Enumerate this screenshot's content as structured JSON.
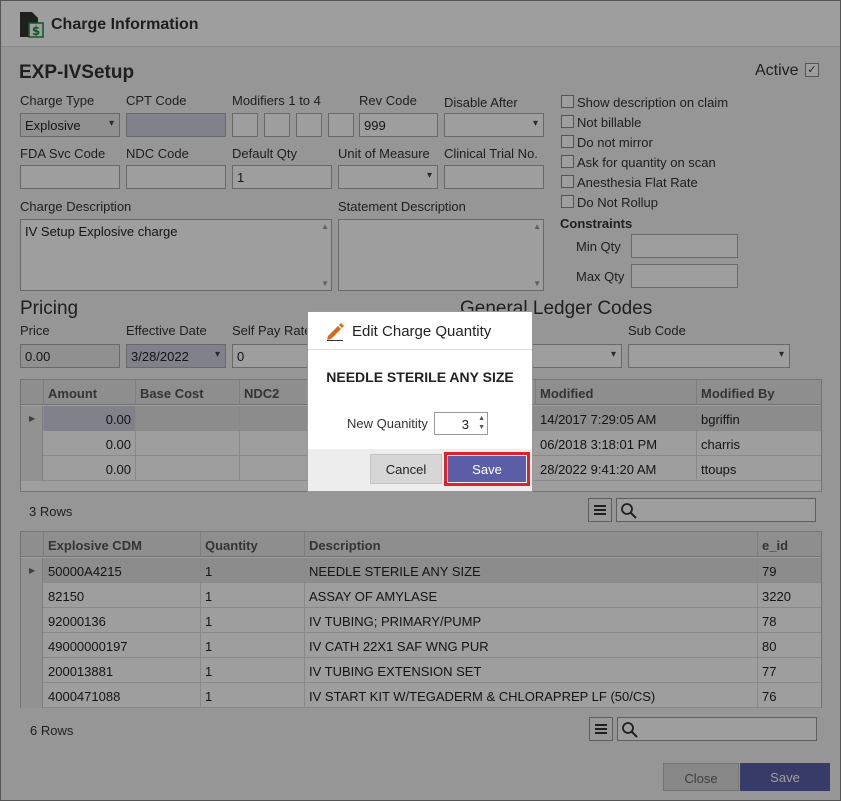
{
  "window": {
    "title": "Charge Information",
    "icon": "document-dollar-icon"
  },
  "charge": {
    "name": "EXP-IVSetup",
    "active_label": "Active",
    "active": true
  },
  "fields": {
    "charge_type": {
      "label": "Charge Type",
      "value": "Explosive"
    },
    "cpt_code": {
      "label": "CPT Code",
      "value": ""
    },
    "modifiers": {
      "label": "Modifiers 1 to 4",
      "values": [
        "",
        "",
        "",
        ""
      ]
    },
    "rev_code": {
      "label": "Rev Code",
      "value": "999"
    },
    "disable_after": {
      "label": "Disable After",
      "value": ""
    },
    "fda_svc_code": {
      "label": "FDA Svc Code",
      "value": ""
    },
    "ndc_code": {
      "label": "NDC Code",
      "value": ""
    },
    "default_qty": {
      "label": "Default Qty",
      "value": "1"
    },
    "unit_of_measure": {
      "label": "Unit of Measure",
      "value": ""
    },
    "clinical_trial_no": {
      "label": "Clinical Trial No.",
      "value": ""
    },
    "charge_description": {
      "label": "Charge Description",
      "value": "IV Setup Explosive charge"
    },
    "statement_description": {
      "label": "Statement Description",
      "value": ""
    }
  },
  "checkboxes": [
    {
      "label": "Show description on claim",
      "checked": false
    },
    {
      "label": "Not billable",
      "checked": false
    },
    {
      "label": "Do not mirror",
      "checked": false
    },
    {
      "label": "Ask for quantity on scan",
      "checked": false
    },
    {
      "label": "Anesthesia Flat Rate",
      "checked": false
    },
    {
      "label": "Do Not Rollup",
      "checked": false
    }
  ],
  "constraints": {
    "title": "Constraints",
    "min_qty_label": "Min Qty",
    "max_qty_label": "Max Qty",
    "min_qty": "",
    "max_qty": ""
  },
  "pricing": {
    "title": "Pricing",
    "price_label": "Price",
    "price": "0.00",
    "effective_date_label": "Effective Date",
    "effective_date": "3/28/2022",
    "self_pay_rate_label": "Self Pay Rate",
    "self_pay_rate": "0"
  },
  "gl": {
    "title": "General Ledger Codes",
    "sub_code_label": "Sub Code",
    "main_code": "",
    "sub_code": ""
  },
  "price_grid": {
    "columns": [
      "Amount",
      "Base Cost",
      "NDC2",
      "Modified",
      "Modified By"
    ],
    "rows": [
      {
        "amount": "0.00",
        "modified": "14/2017 7:29:05 AM",
        "modified_by": "bgriffin"
      },
      {
        "amount": "0.00",
        "modified": "06/2018 3:18:01 PM",
        "modified_by": "charris"
      },
      {
        "amount": "0.00",
        "modified": "28/2022 9:41:20 AM",
        "modified_by": "ttoups"
      }
    ],
    "row_count": "3 Rows"
  },
  "cdm_grid": {
    "columns": [
      "Explosive CDM",
      "Quantity",
      "Description",
      "e_id"
    ],
    "rows": [
      {
        "cdm": "50000A4215",
        "qty": "1",
        "desc": "NEEDLE STERILE ANY SIZE",
        "eid": "79"
      },
      {
        "cdm": "82150",
        "qty": "1",
        "desc": "ASSAY OF AMYLASE",
        "eid": "3220"
      },
      {
        "cdm": "92000136",
        "qty": "1",
        "desc": "IV TUBING; PRIMARY/PUMP",
        "eid": "78"
      },
      {
        "cdm": "49000000197",
        "qty": "1",
        "desc": "IV CATH 22X1 SAF WNG PUR",
        "eid": "80"
      },
      {
        "cdm": "200013881",
        "qty": "1",
        "desc": "IV TUBING EXTENSION SET",
        "eid": "77"
      },
      {
        "cdm": "4000471088",
        "qty": "1",
        "desc": "IV START KIT W/TEGADERM & CHLORAPREP LF (50/CS)",
        "eid": "76"
      }
    ],
    "row_count": "6 Rows"
  },
  "footer": {
    "close_label": "Close",
    "save_label": "Save"
  },
  "dialog": {
    "title": "Edit Charge Quantity",
    "icon": "pencil-icon",
    "item_name": "NEEDLE STERILE ANY SIZE",
    "quantity_label": "New Quanitity",
    "quantity_value": "3",
    "cancel_label": "Cancel",
    "save_label": "Save",
    "accent": "#5b5ea6",
    "highlight": "#e0202a"
  }
}
